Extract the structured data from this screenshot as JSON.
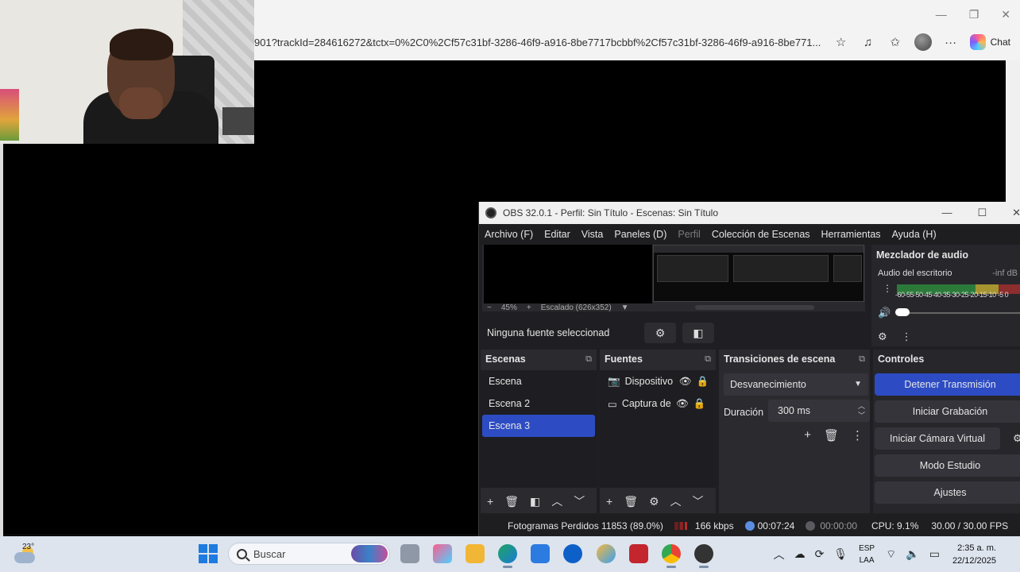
{
  "browser": {
    "url": "901?trackId=284616272&tctx=0%2C0%2Cf57c31bf-3286-46f9-a916-8be7717bcbbf%2Cf57c31bf-3286-46f9-a916-8be771...",
    "chat_label": "Chat"
  },
  "obs": {
    "title": "OBS 32.0.1 - Perfil: Sin Título - Escenas: Sin Título",
    "menu": [
      "Archivo (F)",
      "Editar",
      "Vista",
      "Paneles (D)",
      "Perfil",
      "Colección de Escenas",
      "Herramientas",
      "Ayuda (H)"
    ],
    "zoom": "45%",
    "scale_label": "Escalado (626x352)",
    "no_source": "Ninguna fuente seleccionad",
    "mixer": {
      "title": "Mezclador de audio",
      "track": "Audio del escritorio",
      "db": "-inf dB",
      "scale": "-60-55-50-45-40-35-30-25-20-15-10 -5 0"
    },
    "scenes": {
      "title": "Escenas",
      "items": [
        "Escena",
        "Escena 2",
        "Escena 3"
      ],
      "selected_index": 2
    },
    "sources": {
      "title": "Fuentes",
      "items": [
        "Dispositivo",
        "Captura de"
      ]
    },
    "transitions": {
      "title": "Transiciones de escena",
      "type": "Desvanecimiento",
      "duration_label": "Duración",
      "duration": "300 ms"
    },
    "controls": {
      "title": "Controles",
      "buttons": [
        "Detener Transmisión",
        "Iniciar Grabación",
        "Iniciar Cámara Virtual",
        "Modo Estudio",
        "Ajustes"
      ]
    },
    "status": {
      "dropped": "Fotogramas Perdidos 11853 (89.0%)",
      "bitrate": "166 kbps",
      "stream_time": "00:07:24",
      "rec_time": "00:00:00",
      "cpu": "CPU: 9.1%",
      "fps": "30.00 / 30.00 FPS"
    }
  },
  "taskbar": {
    "temp": "23°",
    "search": "Buscar",
    "lang1": "ESP",
    "lang2": "LAA",
    "time": "2:35 a. m.",
    "date": "22/12/2025"
  }
}
